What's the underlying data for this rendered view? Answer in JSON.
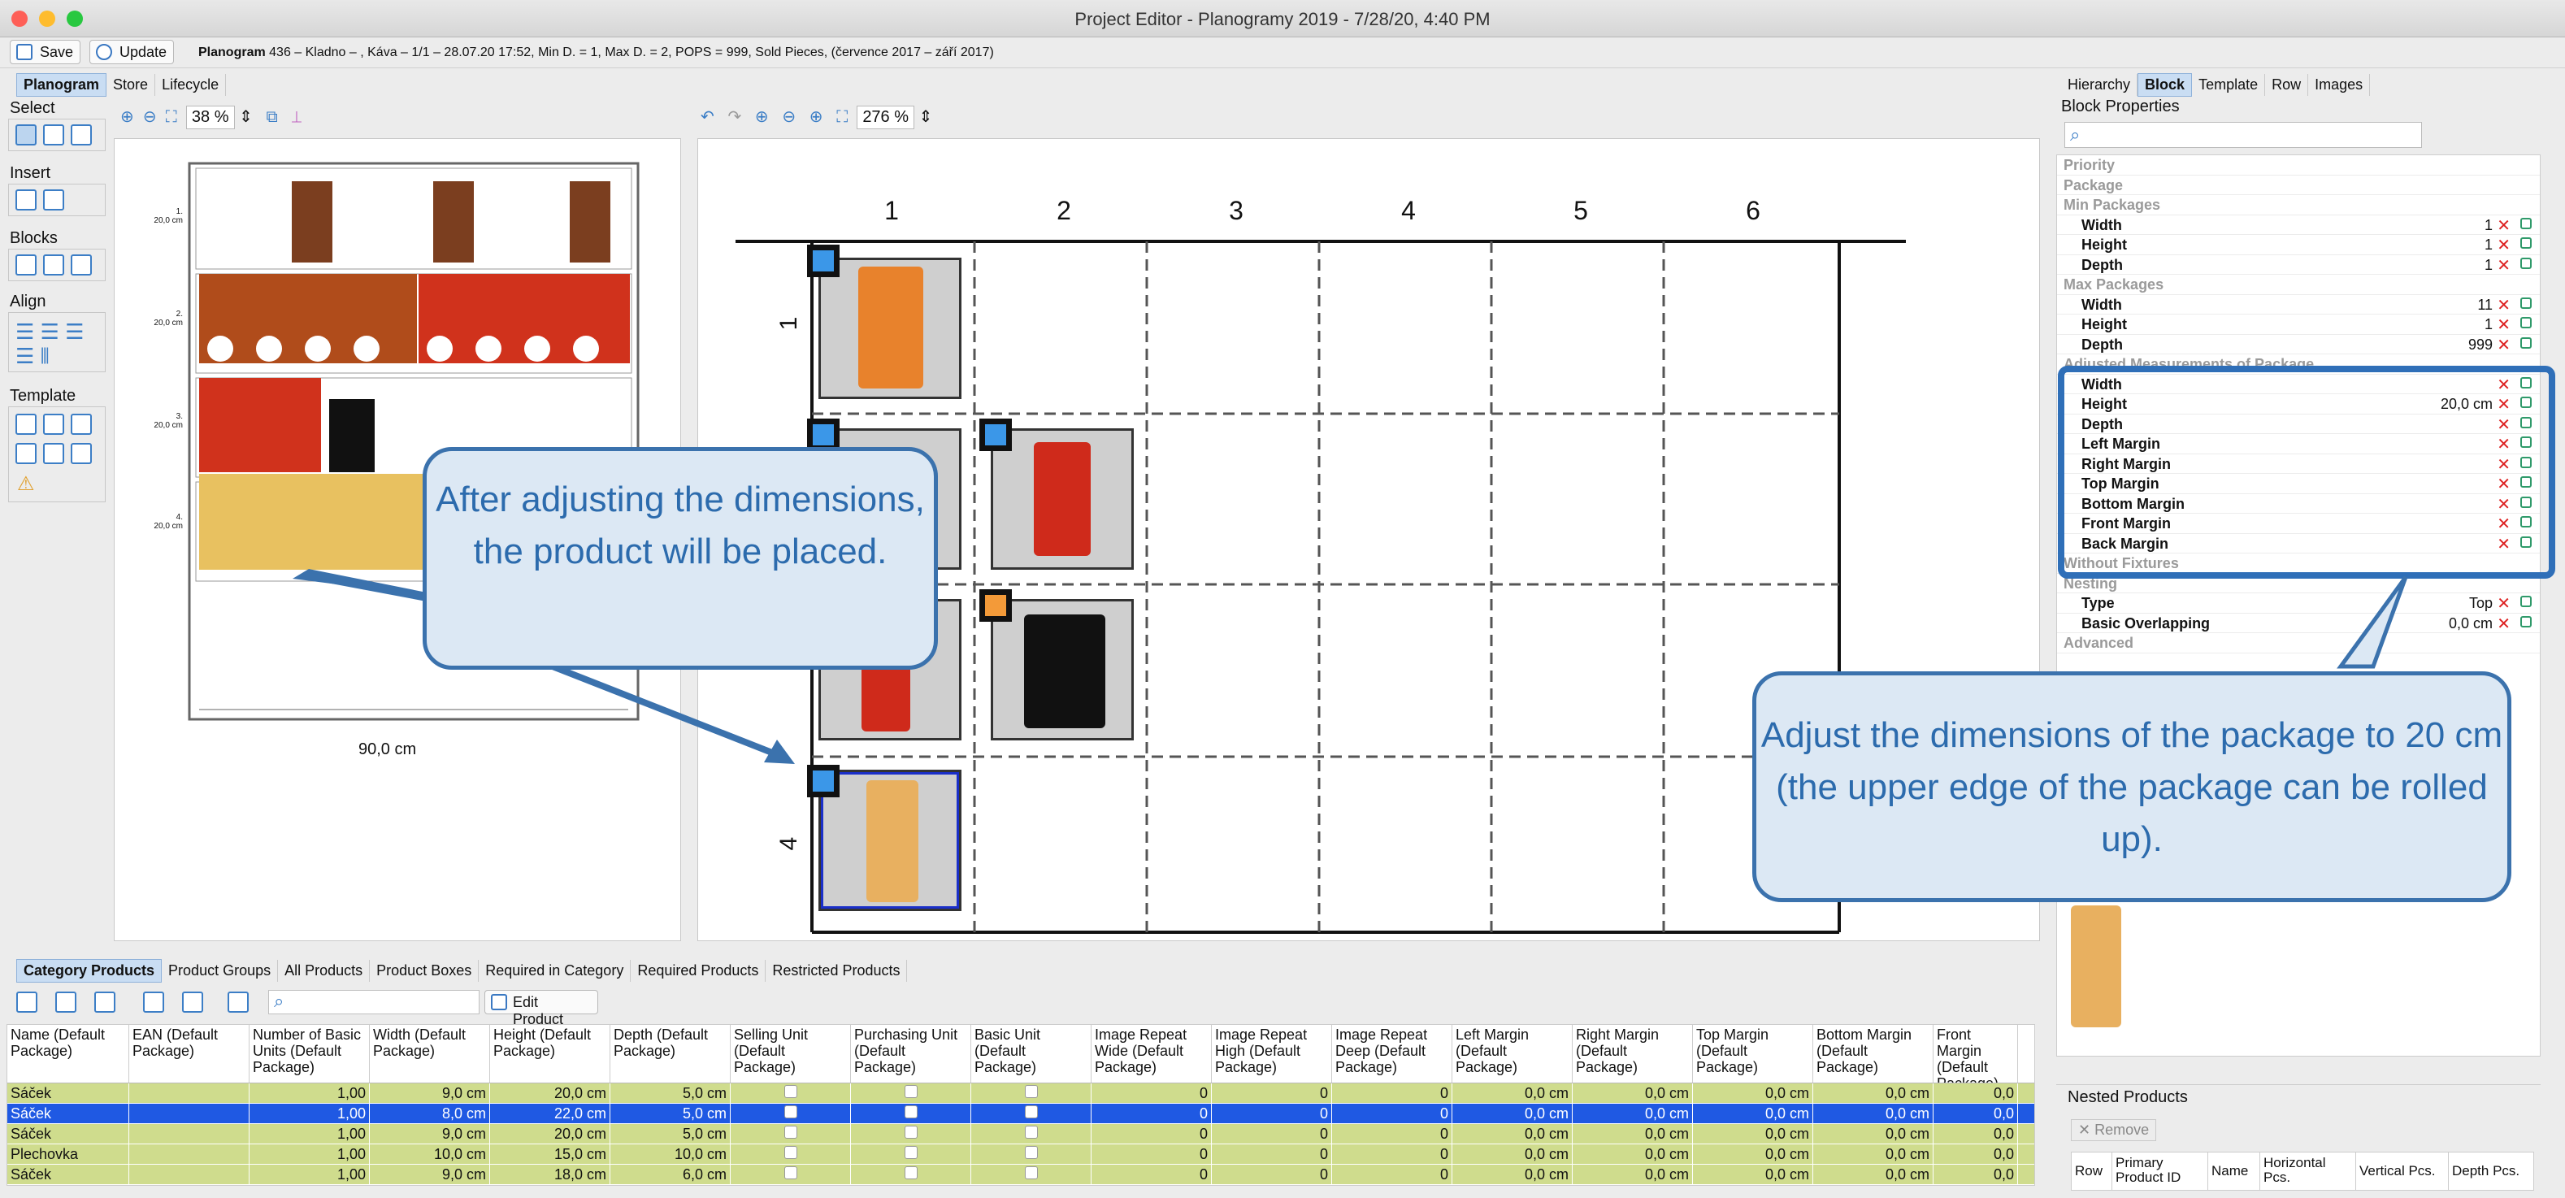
{
  "window": {
    "title": "Project Editor - Planogramy 2019 - 7/28/20, 4:40 PM"
  },
  "toolbar": {
    "save_label": "Save",
    "update_label": "Update",
    "info_bold": "Planogram",
    "info_text": "436 – Kladno – , Káva – 1/1 – 28.07.20 17:52, Min D. = 1, Max D. = 2, POPS = 999, Sold Pieces, (července 2017 – září 2017)"
  },
  "view_tabs": [
    "Planogram",
    "Store",
    "Lifecycle"
  ],
  "left_groups": [
    "Select",
    "Insert",
    "Blocks",
    "Align",
    "Template"
  ],
  "zoom_left": "38 %",
  "zoom_right": "276 %",
  "shelf_labels": [
    {
      "num": "1.",
      "size": "20,0 cm"
    },
    {
      "num": "2.",
      "size": "20,0 cm"
    },
    {
      "num": "3.",
      "size": "20,0 cm"
    },
    {
      "num": "4.",
      "size": "20,0 cm"
    }
  ],
  "shelf_width": "90,0 cm",
  "grid_columns": [
    "1",
    "2",
    "3",
    "4",
    "5",
    "6"
  ],
  "grid_rows": [
    "1",
    "4"
  ],
  "callout_left": "After adjusting the dimensions, the product will be placed.",
  "callout_right": "Adjust the dimensions of the package to 20 cm (the upper edge of the package can be rolled up).",
  "right_tabs": [
    "Hierarchy",
    "Block",
    "Template",
    "Row",
    "Images"
  ],
  "block_properties": {
    "title": "Block Properties",
    "rows": [
      {
        "type": "sec",
        "label": "Priority"
      },
      {
        "type": "sec",
        "label": "Package"
      },
      {
        "type": "sec",
        "label": "Min Packages"
      },
      {
        "type": "row",
        "label": "Width",
        "value": "1"
      },
      {
        "type": "row",
        "label": "Height",
        "value": "1"
      },
      {
        "type": "row",
        "label": "Depth",
        "value": "1"
      },
      {
        "type": "sec",
        "label": "Max Packages"
      },
      {
        "type": "row",
        "label": "Width",
        "value": "11"
      },
      {
        "type": "row",
        "label": "Height",
        "value": "1"
      },
      {
        "type": "row",
        "label": "Depth",
        "value": "999"
      },
      {
        "type": "sec",
        "label": "Adjusted Measurements of Package"
      },
      {
        "type": "row",
        "label": "Width",
        "value": ""
      },
      {
        "type": "row",
        "label": "Height",
        "value": "20,0 cm"
      },
      {
        "type": "row",
        "label": "Depth",
        "value": ""
      },
      {
        "type": "row",
        "label": "Left Margin",
        "value": ""
      },
      {
        "type": "row",
        "label": "Right Margin",
        "value": ""
      },
      {
        "type": "row",
        "label": "Top Margin",
        "value": ""
      },
      {
        "type": "row",
        "label": "Bottom Margin",
        "value": ""
      },
      {
        "type": "row",
        "label": "Front Margin",
        "value": ""
      },
      {
        "type": "row",
        "label": "Back Margin",
        "value": ""
      },
      {
        "type": "sec",
        "label": "Without Fixtures"
      },
      {
        "type": "sec",
        "label": "Nesting"
      },
      {
        "type": "row",
        "label": "Type",
        "value": "Top"
      },
      {
        "type": "row",
        "label": "Basic Overlapping",
        "value": "0,0 cm"
      },
      {
        "type": "sec",
        "label": "Advanced"
      }
    ]
  },
  "nested": {
    "title": "Nested Products",
    "remove_label": "Remove",
    "columns": [
      "Row",
      "Primary Product ID",
      "Name",
      "Horizontal Pcs.",
      "Vertical Pcs.",
      "Depth Pcs."
    ]
  },
  "bottom_tabs": [
    "Category Products",
    "Product Groups",
    "All Products",
    "Product Boxes",
    "Required in Category",
    "Required Products",
    "Restricted Products"
  ],
  "edit_product_label": "Edit Product",
  "table": {
    "columns": [
      "Name (Default Package)",
      "EAN (Default Package)",
      "Number of Basic Units (Default Package)",
      "Width (Default Package)",
      "Height (Default Package)",
      "Depth (Default Package)",
      "Selling Unit (Default Package)",
      "Purchasing Unit (Default Package)",
      "Basic Unit (Default Package)",
      "Image Repeat Wide (Default Package)",
      "Image Repeat High (Default Package)",
      "Image Repeat Deep (Default Package)",
      "Left Margin (Default Package)",
      "Right Margin (Default Package)",
      "Top Margin (Default Package)",
      "Bottom Margin (Default Package)",
      "Front Margin (Default Package)"
    ],
    "rows": [
      [
        "Sáček",
        "",
        "1,00",
        "9,0 cm",
        "20,0 cm",
        "5,0 cm",
        "",
        "",
        "",
        "0",
        "0",
        "0",
        "0,0 cm",
        "0,0 cm",
        "0,0 cm",
        "0,0 cm",
        "0,0"
      ],
      [
        "Sáček",
        "",
        "1,00",
        "8,0 cm",
        "22,0 cm",
        "5,0 cm",
        "",
        "",
        "",
        "0",
        "0",
        "0",
        "0,0 cm",
        "0,0 cm",
        "0,0 cm",
        "0,0 cm",
        "0,0"
      ],
      [
        "Sáček",
        "",
        "1,00",
        "9,0 cm",
        "20,0 cm",
        "5,0 cm",
        "",
        "",
        "",
        "0",
        "0",
        "0",
        "0,0 cm",
        "0,0 cm",
        "0,0 cm",
        "0,0 cm",
        "0,0"
      ],
      [
        "Plechovka",
        "",
        "1,00",
        "10,0 cm",
        "15,0 cm",
        "10,0 cm",
        "",
        "",
        "",
        "0",
        "0",
        "0",
        "0,0 cm",
        "0,0 cm",
        "0,0 cm",
        "0,0 cm",
        "0,0"
      ],
      [
        "Sáček",
        "",
        "1,00",
        "9,0 cm",
        "18,0 cm",
        "6,0 cm",
        "",
        "",
        "",
        "0",
        "0",
        "0",
        "0,0 cm",
        "0,0 cm",
        "0,0 cm",
        "0,0 cm",
        "0,0"
      ]
    ],
    "selected_row": 1
  },
  "colors": {
    "accent": "#3b72ad",
    "row_green": "#cfdc8d",
    "row_selected": "#1f59e3"
  }
}
